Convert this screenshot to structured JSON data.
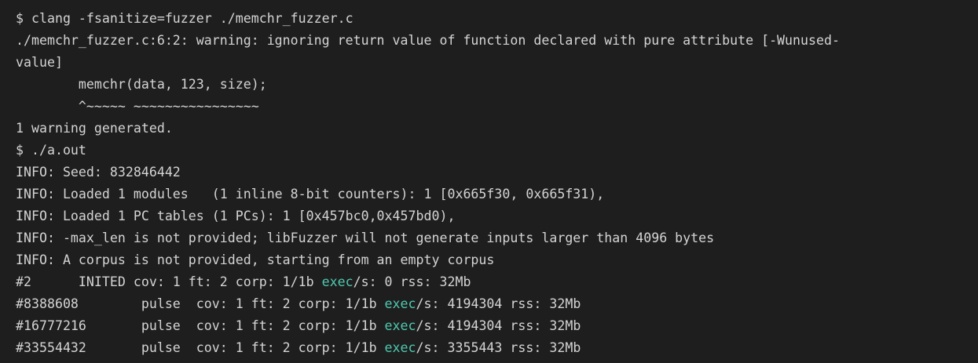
{
  "terminal": {
    "lines": [
      {
        "pre": "$ clang -fsanitize=fuzzer ./memchr_fuzzer.c",
        "kw": "",
        "post": ""
      },
      {
        "pre": "./memchr_fuzzer.c:6:2: warning: ignoring return value of function declared with pure attribute [-Wunused-",
        "kw": "",
        "post": ""
      },
      {
        "pre": "value]",
        "kw": "",
        "post": ""
      },
      {
        "pre": "        memchr(data, 123, size);",
        "kw": "",
        "post": ""
      },
      {
        "pre": "        ^~~~~~ ~~~~~~~~~~~~~~~~",
        "kw": "",
        "post": ""
      },
      {
        "pre": "1 warning generated.",
        "kw": "",
        "post": ""
      },
      {
        "pre": "$ ./a.out",
        "kw": "",
        "post": ""
      },
      {
        "pre": "INFO: Seed: 832846442",
        "kw": "",
        "post": ""
      },
      {
        "pre": "INFO: Loaded 1 modules   (1 inline 8-bit counters): 1 [0x665f30, 0x665f31),",
        "kw": "",
        "post": ""
      },
      {
        "pre": "INFO: Loaded 1 PC tables (1 PCs): 1 [0x457bc0,0x457bd0),",
        "kw": "",
        "post": ""
      },
      {
        "pre": "INFO: -max_len is not provided; libFuzzer will not generate inputs larger than 4096 bytes",
        "kw": "",
        "post": ""
      },
      {
        "pre": "INFO: A corpus is not provided, starting from an empty corpus",
        "kw": "",
        "post": ""
      },
      {
        "pre": "#2      INITED cov: 1 ft: 2 corp: 1/1b ",
        "kw": "exec",
        "post": "/s: 0 rss: 32Mb"
      },
      {
        "pre": "#8388608        pulse  cov: 1 ft: 2 corp: 1/1b ",
        "kw": "exec",
        "post": "/s: 4194304 rss: 32Mb"
      },
      {
        "pre": "#16777216       pulse  cov: 1 ft: 2 corp: 1/1b ",
        "kw": "exec",
        "post": "/s: 4194304 rss: 32Mb"
      },
      {
        "pre": "#33554432       pulse  cov: 1 ft: 2 corp: 1/1b ",
        "kw": "exec",
        "post": "/s: 3355443 rss: 32Mb"
      }
    ],
    "colors": {
      "background": "#1e1e1e",
      "foreground": "#d4d4d4",
      "highlight": "#4ec9b0"
    }
  }
}
